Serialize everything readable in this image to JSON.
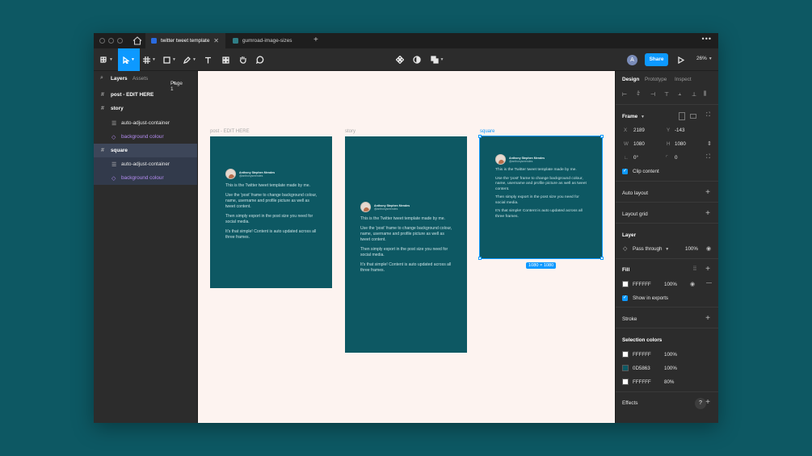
{
  "window": {
    "tabs": [
      {
        "label": "twitter tweet template",
        "active": true
      },
      {
        "label": "gumroad-image-sizes",
        "active": false
      }
    ]
  },
  "toolbar": {
    "avatar_initial": "A",
    "share_label": "Share",
    "zoom": "26%"
  },
  "left_panel": {
    "tabs": [
      "Layers",
      "Assets"
    ],
    "page": "Page 1",
    "layers": [
      {
        "label": "post - EDIT HERE",
        "level": 0
      },
      {
        "label": "story",
        "level": 0
      },
      {
        "label": "auto-adjust-container",
        "level": 1
      },
      {
        "label": "background colour",
        "level": 1
      },
      {
        "label": "square",
        "level": 0
      },
      {
        "label": "auto-adjust-container",
        "level": 1
      },
      {
        "label": "background colour",
        "level": 1
      }
    ]
  },
  "canvas": {
    "frames": [
      {
        "label": "post - EDIT HERE"
      },
      {
        "label": "story"
      },
      {
        "label": "square"
      }
    ],
    "size_badge": "1080 × 1080",
    "card": {
      "name": "Anthony Stephen Mendes",
      "handle": "@anthonysmendes",
      "p1": "This is the Twitter tweet template made by me.",
      "p2": "Use the 'post' frame to change background colour, name, username and profile picture as well as tweet content.",
      "p3": "Then simply export in the post size you need for social media.",
      "p4": "It's that simple! Content is auto updated across all three frames."
    }
  },
  "right_panel": {
    "tabs": [
      "Design",
      "Prototype",
      "Inspect"
    ],
    "frame_title": "Frame",
    "x_label": "X",
    "x_value": "2189",
    "y_label": "Y",
    "y_value": "-143",
    "w_label": "W",
    "w_value": "1080",
    "h_label": "H",
    "h_value": "1080",
    "rotation": "0°",
    "radius": "0",
    "clip_content": "Clip content",
    "auto_layout": "Auto layout",
    "layout_grid": "Layout grid",
    "layer_title": "Layer",
    "blend": "Pass through",
    "layer_opacity": "100%",
    "fill_title": "Fill",
    "fill_hex": "FFFFFF",
    "fill_opacity": "100%",
    "show_in_exports": "Show in exports",
    "stroke": "Stroke",
    "selection_colors_title": "Selection colors",
    "selection_colors": [
      {
        "hex": "FFFFFF",
        "opacity": "100%",
        "color": "#FFFFFF"
      },
      {
        "hex": "0D5863",
        "opacity": "100%",
        "color": "#0D5863"
      },
      {
        "hex": "FFFFFF",
        "opacity": "80%",
        "color": "#FFFFFF"
      }
    ],
    "effects": "Effects",
    "help": "?"
  }
}
